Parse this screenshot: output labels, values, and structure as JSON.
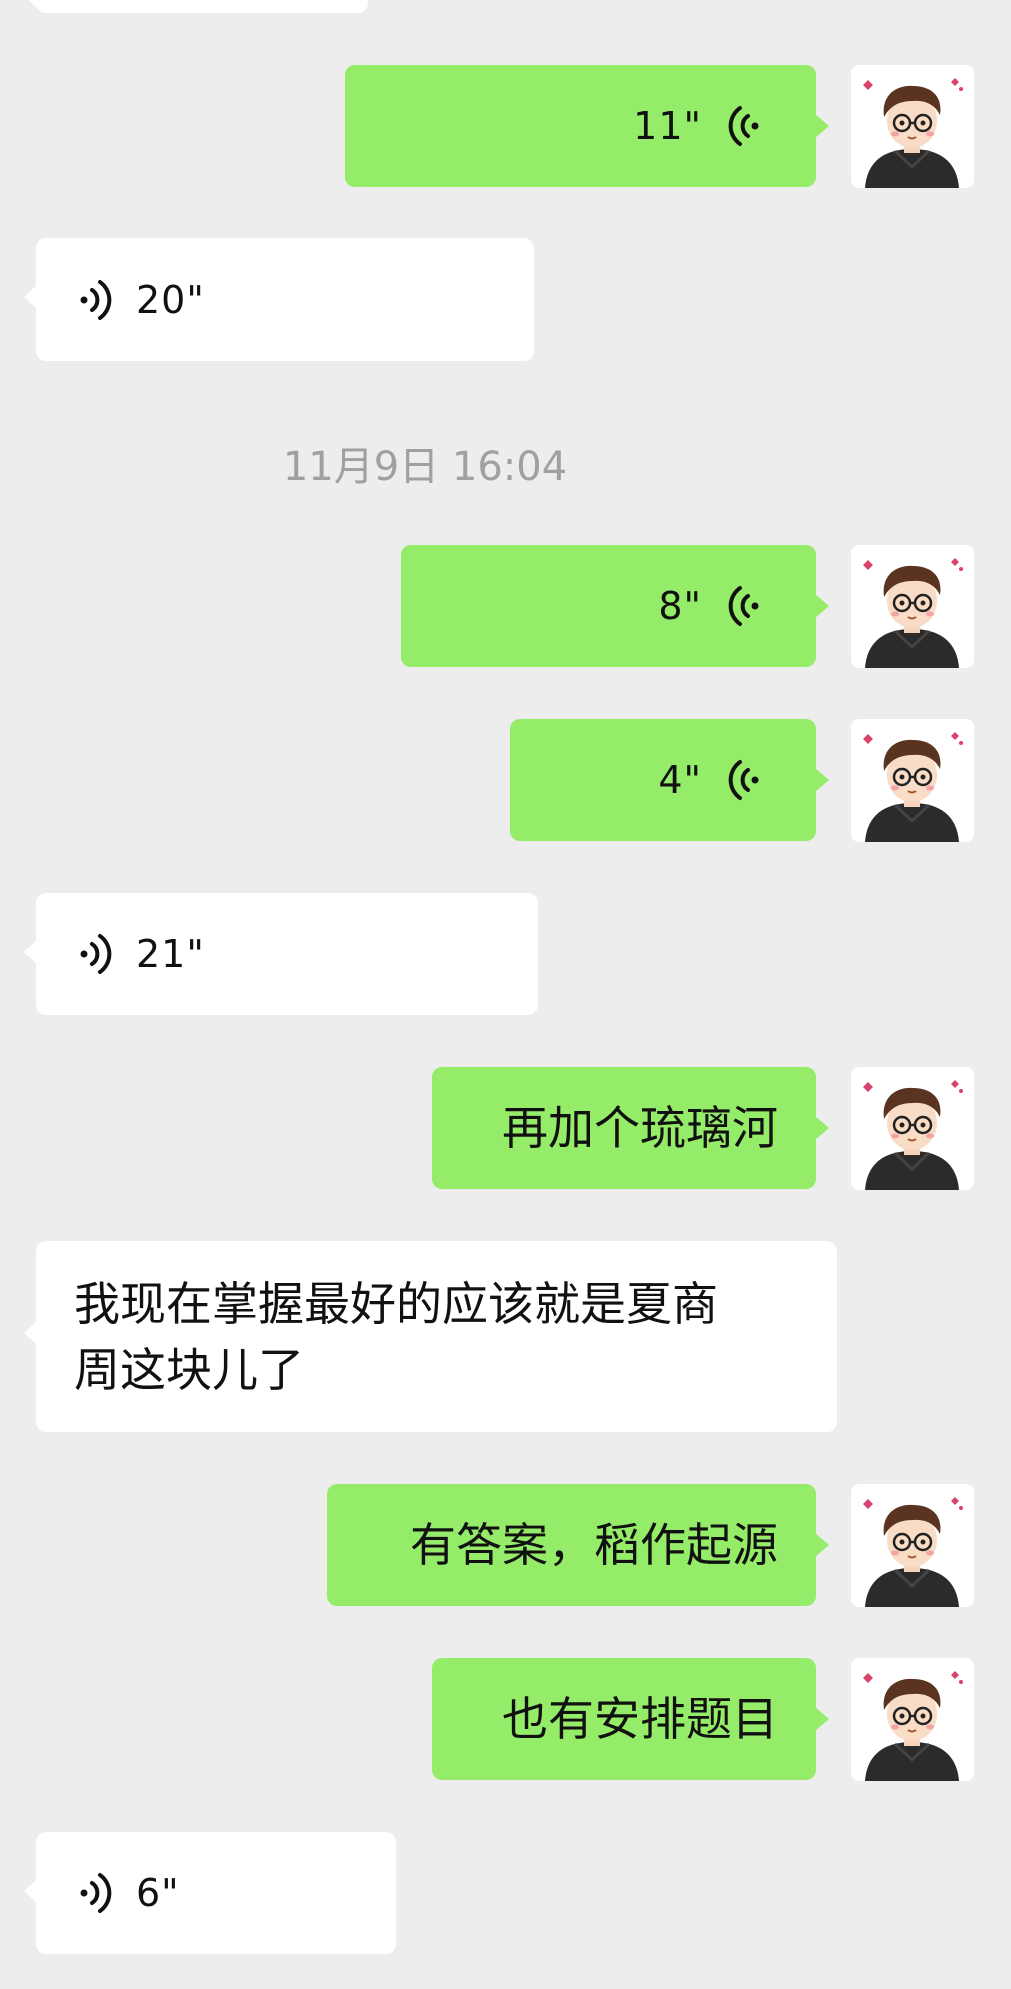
{
  "conversation": {
    "timestamp": "11月9日 16:04",
    "messages": [
      {
        "id": "m1",
        "side": "outgoing",
        "type": "voice",
        "duration": "11\""
      },
      {
        "id": "m2",
        "side": "incoming",
        "type": "voice",
        "duration": "20\""
      },
      {
        "id": "m3",
        "side": "outgoing",
        "type": "voice",
        "duration": "8\""
      },
      {
        "id": "m4",
        "side": "outgoing",
        "type": "voice",
        "duration": "4\""
      },
      {
        "id": "m5",
        "side": "incoming",
        "type": "voice",
        "duration": "21\""
      },
      {
        "id": "m6",
        "side": "outgoing",
        "type": "text",
        "text": "再加个琉璃河"
      },
      {
        "id": "m7",
        "side": "incoming",
        "type": "text",
        "text_line1": "我现在掌握最好的应该就是夏商",
        "text_line2": "周这块儿了"
      },
      {
        "id": "m8",
        "side": "outgoing",
        "type": "text",
        "text": "有答案，稻作起源"
      },
      {
        "id": "m9",
        "side": "outgoing",
        "type": "text",
        "text": "也有安排题目"
      },
      {
        "id": "m10",
        "side": "incoming",
        "type": "voice",
        "duration": "6\""
      }
    ]
  },
  "colors": {
    "background": "#ededed",
    "incoming_bubble": "#ffffff",
    "outgoing_bubble": "#95ec69",
    "timestamp_text": "#a0a0a0"
  },
  "icons": {
    "voice_outgoing": "voice-wave-icon",
    "voice_incoming": "voice-wave-icon",
    "avatar": "cartoon-boy-avatar"
  }
}
